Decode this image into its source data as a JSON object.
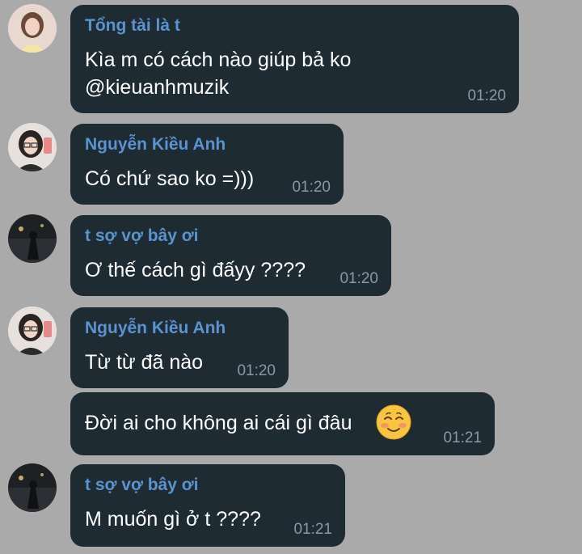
{
  "colors": {
    "background": "#aaaaaa",
    "bubble": "#1f2b33",
    "sender_name": "#5a93cf",
    "message_text": "#ffffff",
    "timestamp": "#8a98a4"
  },
  "messages": [
    {
      "sender": "Tổng tài là t",
      "lines": [
        "Kìa m có cách nào giúp bả ko",
        "@kieuanhmuzik"
      ],
      "time": "01:20",
      "avatar": "girl-selfie-avatar"
    },
    {
      "sender": "Nguyễn Kiều Anh",
      "lines": [
        "Có chứ sao ko =)))"
      ],
      "time": "01:20",
      "avatar": "girl-glasses-avatar"
    },
    {
      "sender": "t sợ vợ bây ơi",
      "lines": [
        "Ơ thế cách gì đấyy ????"
      ],
      "time": "01:20",
      "avatar": "dark-street-avatar"
    },
    {
      "sender": "Nguyễn Kiều Anh",
      "lines": [
        "Từ từ đã nào"
      ],
      "time": "01:20",
      "avatar": "girl-glasses-avatar"
    },
    {
      "sender": "",
      "lines": [
        "Đời ai cho không ai cái gì đâu"
      ],
      "emoji": "smiling-face-emoji",
      "time": "01:21"
    },
    {
      "sender": "t sợ vợ bây ơi",
      "lines": [
        "M muốn gì ở t ????"
      ],
      "time": "01:21",
      "avatar": "dark-street-avatar"
    }
  ]
}
